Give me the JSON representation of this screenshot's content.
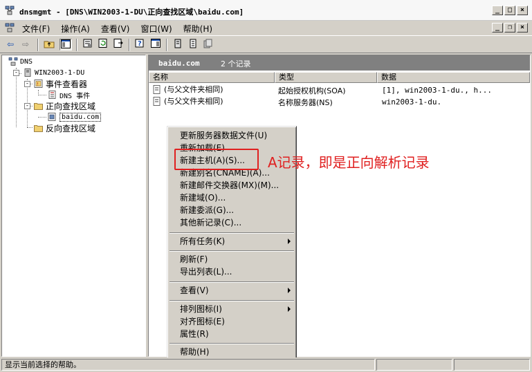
{
  "window": {
    "title": "dnsmgmt - [DNS\\WIN2003-1-DU\\正向查找区域\\baidu.com]",
    "minimize": "_",
    "maximize": "□",
    "close": "×"
  },
  "menubar": {
    "items": [
      "文件(F)",
      "操作(A)",
      "查看(V)",
      "窗口(W)",
      "帮助(H)"
    ],
    "child_min": "_",
    "child_restore": "❐",
    "child_close": "×"
  },
  "tree": {
    "dns": "DNS",
    "server": "WIN2003-1-DU",
    "event_viewer": "事件查看器",
    "dns_events": "DNS 事件",
    "forward_zones": "正向查找区域",
    "baidu": "baidu.com",
    "reverse_zones": "反向查找区域"
  },
  "details": {
    "zone_name": "baidu.com",
    "record_count": "2 个记录",
    "columns": [
      "名称",
      "类型",
      "数据"
    ],
    "rows": [
      {
        "name": "(与父文件夹相同)",
        "type": "起始授权机构(SOA)",
        "data": "[1], win2003-1-du., h..."
      },
      {
        "name": "(与父文件夹相同)",
        "type": "名称服务器(NS)",
        "data": "win2003-1-du."
      }
    ]
  },
  "context_menu": {
    "group1": [
      "更新服务器数据文件(U)",
      "重新加载(E)",
      "新建主机(A)(S)...",
      "新建别名(CNAME)(A)...",
      "新建邮件交换器(MX)(M)...",
      "新建域(O)...",
      "新建委派(G)...",
      "其他新记录(C)..."
    ],
    "group2": [
      "所有任务(K)"
    ],
    "group3": [
      "刷新(F)",
      "导出列表(L)..."
    ],
    "group4": [
      "查看(V)"
    ],
    "group5": [
      "排列图标(I)",
      "对齐图标(E)",
      "属性(R)"
    ],
    "group6": [
      "帮助(H)"
    ]
  },
  "annotation": {
    "text": "A记录，即是正向解析记录",
    "color": "#e02020"
  },
  "statusbar": {
    "text": "显示当前选择的帮助。"
  },
  "colors": {
    "desc_bar": "#808080",
    "face": "#d4d0c8",
    "highlight_border": "#e02020"
  }
}
